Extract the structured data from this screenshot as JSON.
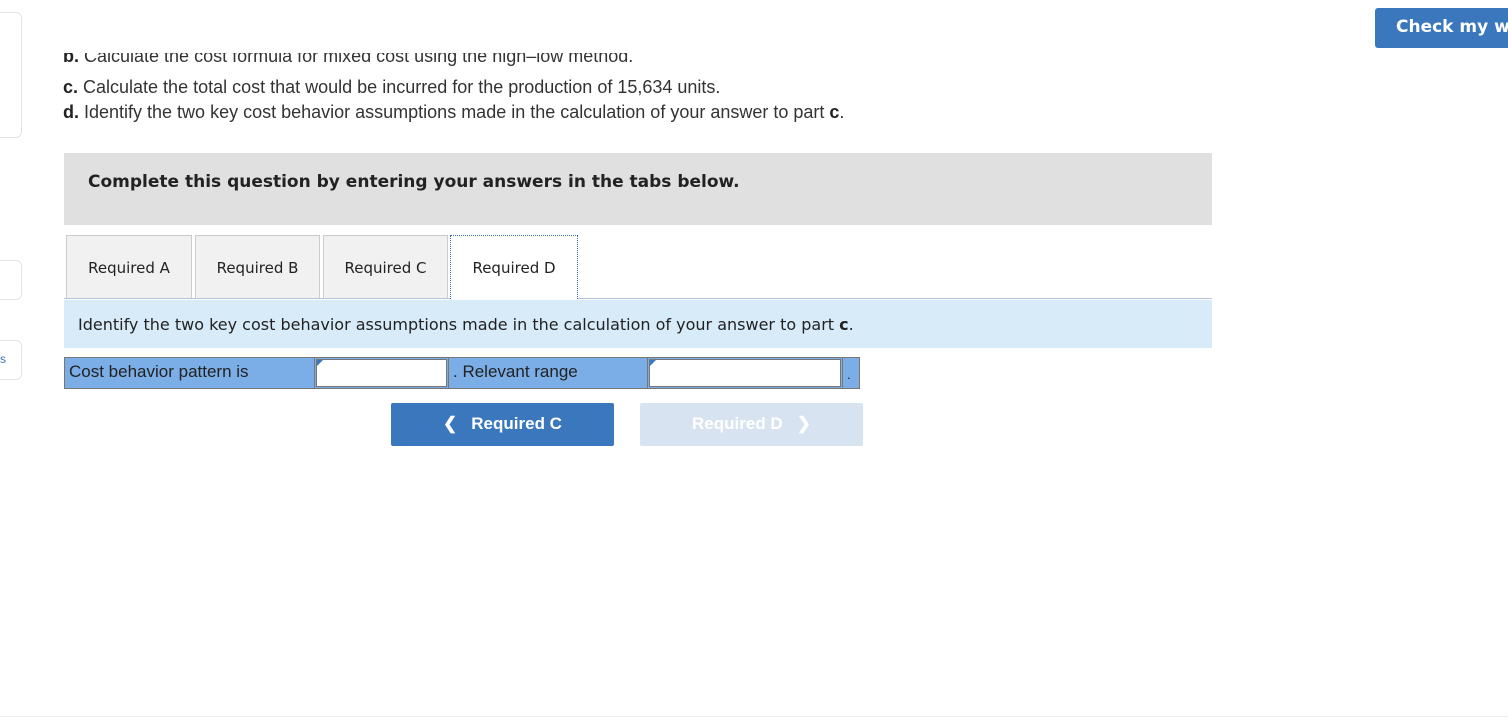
{
  "header": {
    "check_label": "Check my wo"
  },
  "sidebar": {
    "fragment_text": "s"
  },
  "question": {
    "b": {
      "letter": "b.",
      "text": " Calculate the cost formula for mixed cost using the high–low method."
    },
    "c": {
      "letter": "c.",
      "text": " Calculate the total cost that would be incurred for the production of 15,634 units."
    },
    "d": {
      "letter": "d.",
      "text": " Identify the two key cost behavior assumptions made in the calculation of your answer to part ",
      "part": "c",
      "end": "."
    }
  },
  "banner": "Complete this question by entering your answers in the tabs below.",
  "tabs": [
    {
      "label": "Required A"
    },
    {
      "label": "Required B"
    },
    {
      "label": "Required C"
    },
    {
      "label": "Required D",
      "active": true
    }
  ],
  "instruction": {
    "text": "Identify the two key cost behavior assumptions made in the calculation of your answer to part ",
    "part": "c",
    "end": "."
  },
  "answer_row": {
    "label1": "Cost behavior pattern is",
    "input1": "",
    "label2": ". Relevant range",
    "input2": "",
    "end": "."
  },
  "nav": {
    "prev_label": "Required C",
    "next_label": "Required D",
    "next_disabled": true
  }
}
